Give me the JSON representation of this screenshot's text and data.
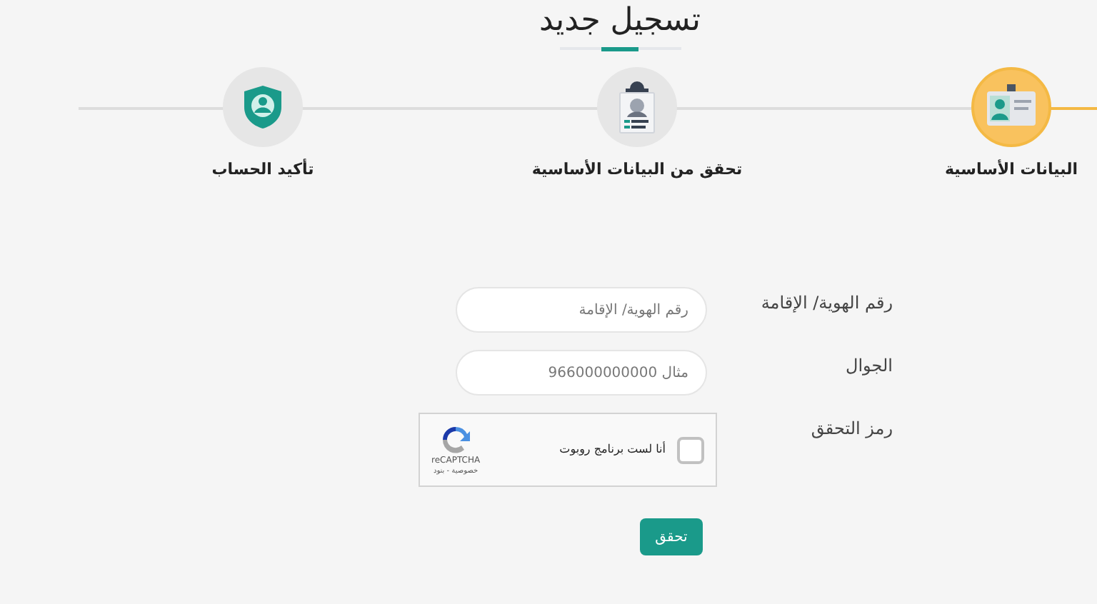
{
  "title": "تسجيل جديد",
  "steps": [
    {
      "label": "البيانات الأساسية",
      "active": true,
      "kind": "id-card"
    },
    {
      "label": "تحقق من البيانات الأساسية",
      "active": false,
      "kind": "badge"
    },
    {
      "label": "تأكيد الحساب",
      "active": false,
      "kind": "shield"
    }
  ],
  "fields": [
    {
      "kind": "input",
      "label": "رقم الهوية/ الإقامة",
      "placeholder": "رقم الهوية/ الإقامة"
    },
    {
      "kind": "input",
      "label": "الجوال",
      "placeholder": "مثال 966000000000"
    },
    {
      "kind": "captcha",
      "label": "رمز التحقق",
      "checkbox_text": "أنا لست برنامج روبوت",
      "checked": false,
      "brand": "reCAPTCHA",
      "footer": "خصوصية - بنود"
    }
  ],
  "submit": "تحقق"
}
